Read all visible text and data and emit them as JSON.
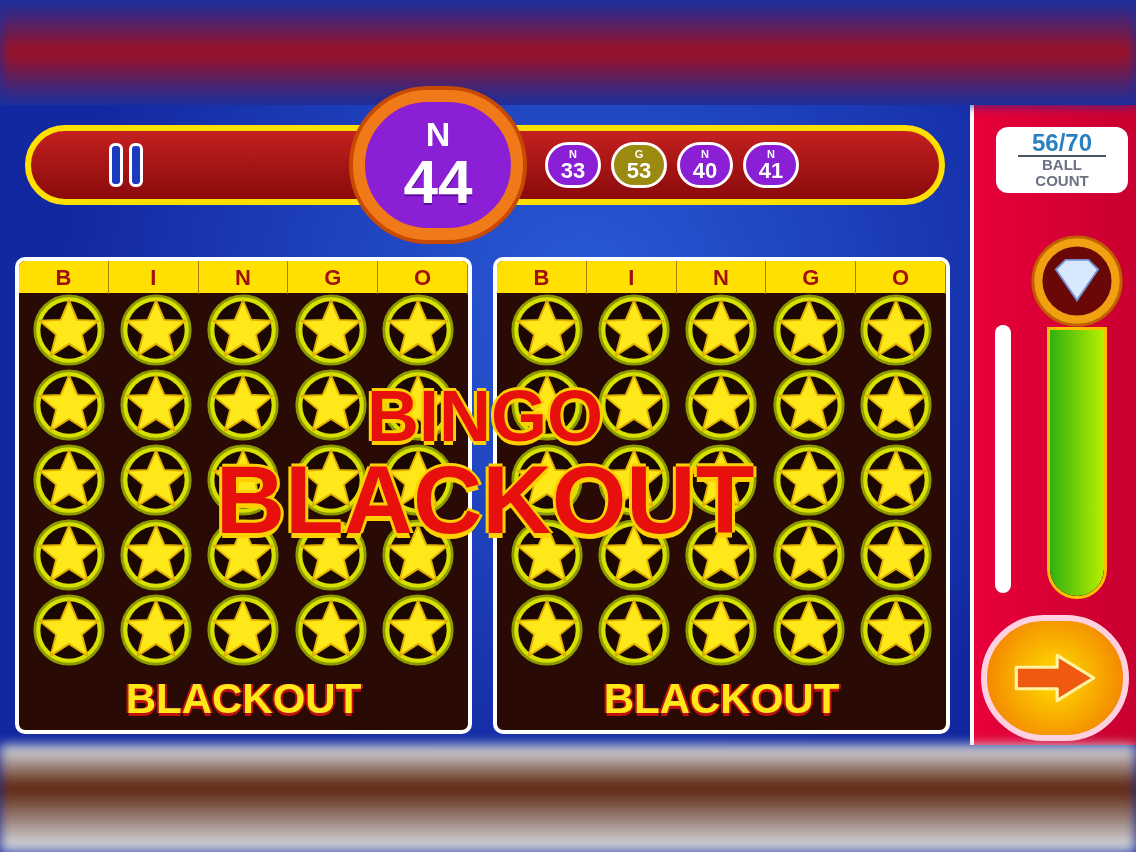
{
  "top_bar": {
    "current_ball": {
      "letter": "N",
      "number": "44",
      "color": "#8a1fd6"
    },
    "recent_balls": [
      {
        "letter": "N",
        "number": "33",
        "color": "#8a1fd6"
      },
      {
        "letter": "G",
        "number": "53",
        "color": "#9a8a10"
      },
      {
        "letter": "N",
        "number": "40",
        "color": "#8a1fd6"
      },
      {
        "letter": "N",
        "number": "41",
        "color": "#8a1fd6"
      }
    ]
  },
  "cards": [
    {
      "header": [
        "B",
        "I",
        "N",
        "G",
        "O"
      ],
      "label": "BLACKOUT",
      "cells": [
        {
          "marked": true
        },
        {
          "marked": true
        },
        {
          "marked": true
        },
        {
          "marked": true
        },
        {
          "marked": true
        },
        {
          "marked": true
        },
        {
          "marked": true
        },
        {
          "marked": true
        },
        {
          "marked": true
        },
        {
          "marked": true
        },
        {
          "marked": true
        },
        {
          "marked": true
        },
        {
          "marked": true
        },
        {
          "marked": true
        },
        {
          "marked": true
        },
        {
          "marked": true
        },
        {
          "marked": true
        },
        {
          "marked": true
        },
        {
          "marked": true
        },
        {
          "marked": true
        },
        {
          "marked": true
        },
        {
          "marked": true
        },
        {
          "marked": true
        },
        {
          "marked": true
        },
        {
          "marked": true
        }
      ]
    },
    {
      "header": [
        "B",
        "I",
        "N",
        "G",
        "O"
      ],
      "label": "BLACKOUT",
      "cells": [
        {
          "marked": true
        },
        {
          "marked": true
        },
        {
          "marked": true
        },
        {
          "marked": true
        },
        {
          "marked": true
        },
        {
          "marked": true
        },
        {
          "marked": true
        },
        {
          "marked": true
        },
        {
          "marked": true
        },
        {
          "marked": true
        },
        {
          "marked": true
        },
        {
          "marked": true
        },
        {
          "marked": true
        },
        {
          "marked": true
        },
        {
          "marked": true
        },
        {
          "marked": true
        },
        {
          "marked": true
        },
        {
          "marked": true
        },
        {
          "marked": true
        },
        {
          "marked": true
        },
        {
          "marked": true
        },
        {
          "marked": true
        },
        {
          "marked": true
        },
        {
          "marked": true
        },
        {
          "marked": true
        }
      ]
    }
  ],
  "banner": {
    "line_1": "BINGO",
    "line_2": "BLACKOUT"
  },
  "side_panel": {
    "ball_count": {
      "value": "56/70",
      "label": "BALL COUNT"
    },
    "meter": {
      "level": 1
    }
  }
}
